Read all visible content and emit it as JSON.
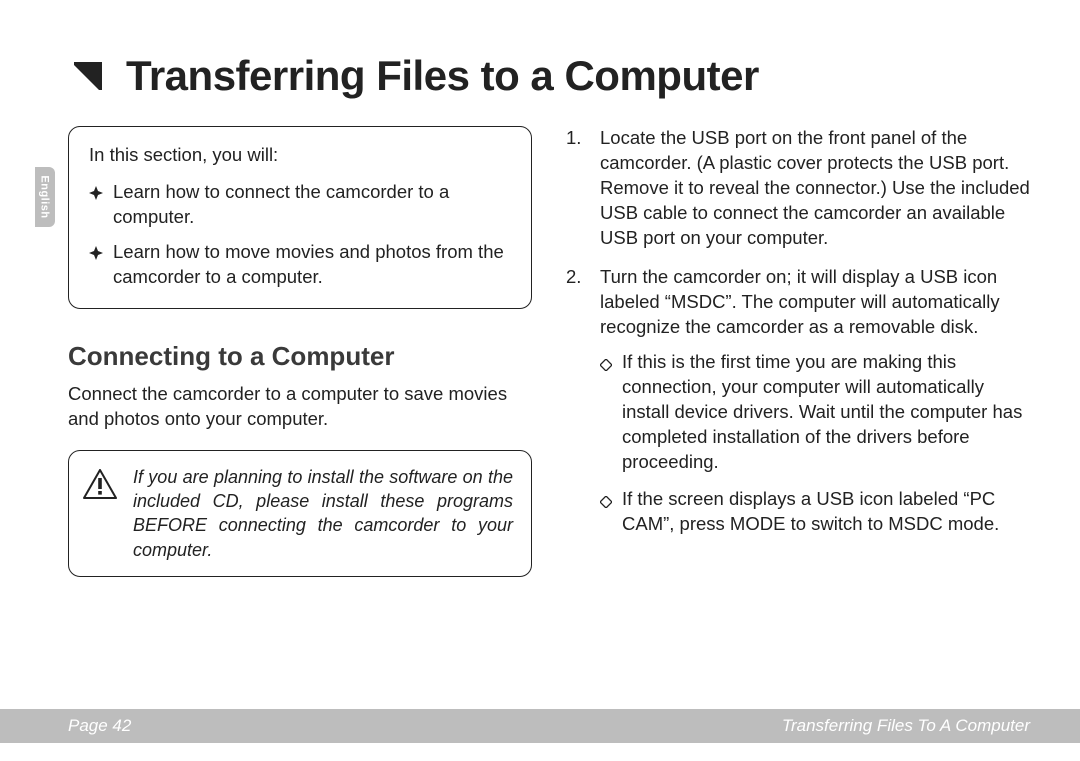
{
  "language_tab": "English",
  "title": "Transferring Files to a Computer",
  "section_box": {
    "intro": "In this section, you will:",
    "items": [
      "Learn how to connect the camcorder to a computer.",
      "Learn how to move movies and photos from the camcorder to a computer."
    ]
  },
  "subhead": "Connecting to a Computer",
  "intro_para": "Connect the camcorder to a computer to save movies and photos onto your computer.",
  "warning": "If you are planning to install the software on the included CD, please install these programs BEFORE connecting the camcorder to your computer.",
  "steps": [
    {
      "text": "Locate the USB port on the front panel of the camcorder. (A plastic cover protects the USB port. Remove it to reveal the connector.) Use the included USB cable to connect the camcorder an available USB port on your computer.",
      "sub": []
    },
    {
      "text": "Turn the camcorder on; it will display a USB icon labeled “MSDC”. The computer will automatically recognize the camcorder as a removable disk.",
      "sub": [
        "If this is the first time you are making this connection, your computer will automatically install device drivers. Wait until the computer has completed installation of the drivers before proceeding.",
        "If the screen displays a USB icon labeled “PC CAM”, press MODE to switch to MSDC mode."
      ]
    }
  ],
  "footer": {
    "page_label": "Page 42",
    "chapter": "Transferring Files To A Computer"
  }
}
